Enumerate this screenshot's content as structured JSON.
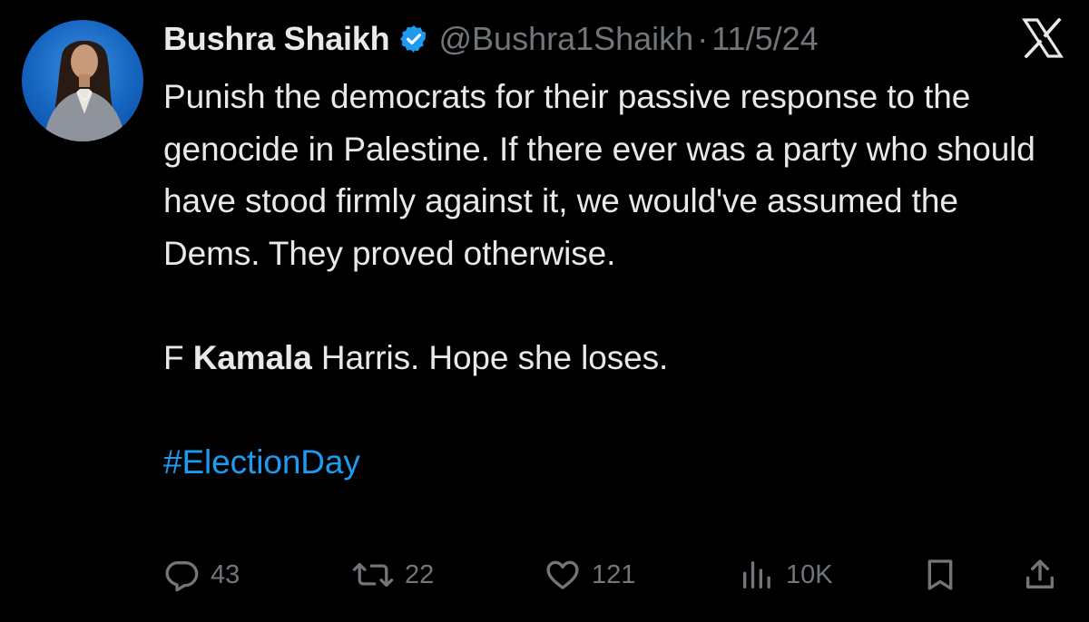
{
  "author": {
    "name": "Bushra Shaikh",
    "handle": "@Bushra1Shaikh",
    "separator": "·",
    "date": "11/5/24",
    "verified": true,
    "verified_color": "#1d9bf0",
    "avatar_icon": "avatar-photo"
  },
  "platform": {
    "logo": "x-logo-icon"
  },
  "tweet": {
    "paragraph_1": "Punish the democrats for their passive  response to the genocide in Palestine. If there ever was a party who should have stood firmly against it, we would've assumed the Dems. They proved otherwise.",
    "line_2_prefix": "F ",
    "line_2_bold": "Kamala",
    "line_2_suffix": " Harris. Hope she loses.",
    "hashtag": "#ElectionDay",
    "hashtag_color": "#1d9bf0"
  },
  "actions": {
    "replies": {
      "icon": "reply-icon",
      "count": "43"
    },
    "reposts": {
      "icon": "repost-icon",
      "count": "22"
    },
    "likes": {
      "icon": "heart-icon",
      "count": "121"
    },
    "views": {
      "icon": "views-icon",
      "count": "10K"
    },
    "bookmark": {
      "icon": "bookmark-icon"
    },
    "share": {
      "icon": "share-icon"
    }
  },
  "colors": {
    "background": "#000000",
    "text_primary": "#e7e9ea",
    "text_secondary": "#71767b"
  }
}
